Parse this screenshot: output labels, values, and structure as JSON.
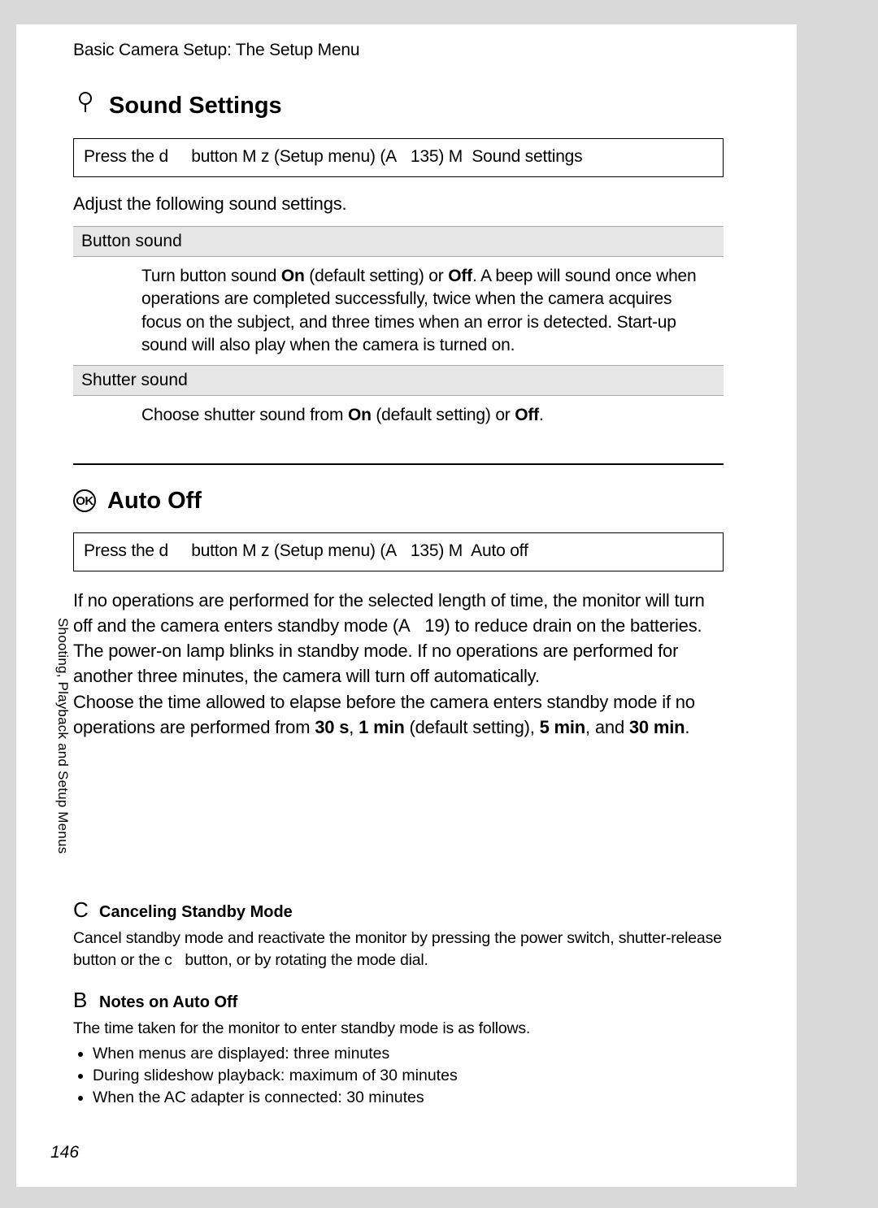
{
  "breadcrumb": "Basic Camera Setup: The Setup Menu",
  "side_label": "Shooting, Playback and Setup Menus",
  "page_number": "146",
  "sound_settings": {
    "icon_name": "sound-icon",
    "title": "Sound Settings",
    "nav_pre": "Press the d",
    "nav_mid1": "button M z  (Setup menu) (A",
    "nav_page": "135) M",
    "nav_end": "Sound settings",
    "intro": "Adjust the following sound settings.",
    "options": [
      {
        "label": "Button sound",
        "desc_pre": "Turn button sound ",
        "on": "On",
        "desc_mid1": " (default setting) or ",
        "off": "Off",
        "desc_post": ". A beep will sound once when operations are completed successfully, twice when the camera acquires focus on the subject, and three times when an error is detected. Start-up sound will also play when the camera is turned on."
      },
      {
        "label": "Shutter sound",
        "desc_pre": "Choose shutter sound from ",
        "on": "On",
        "desc_mid1": " (default setting) or ",
        "off": "Off",
        "desc_post": "."
      }
    ]
  },
  "auto_off": {
    "icon_text": "OK",
    "title": "Auto Off",
    "nav_pre": "Press the d",
    "nav_mid1": "button M z  (Setup menu) (A",
    "nav_page": "135) M",
    "nav_end": "Auto off",
    "para1_pre": "If no operations are performed for the selected length of time, the monitor will turn off and the camera enters standby mode (A",
    "para1_ref": "19) to reduce drain on the batteries. The power-on lamp blinks in standby mode. If no operations are performed for another three minutes, the camera will turn off automatically.",
    "para2_pre": "Choose the time allowed to elapse before the camera enters standby mode if no operations are performed from ",
    "opt1": "30 s",
    "sep1": ", ",
    "opt2": "1 min",
    "def": " (default setting), ",
    "opt3": "5 min",
    "sep2": ", and ",
    "opt4": "30 min",
    "end": "."
  },
  "note_cancel": {
    "icon": "C",
    "title": "Canceling Standby Mode",
    "body_pre": "Cancel standby mode and reactivate the monitor by pressing the power switch, shutter-release button or the ",
    "btn": "c",
    "body_post": " button, or by rotating the mode dial."
  },
  "note_auto": {
    "icon": "B",
    "title": "Notes on Auto Off",
    "intro": "The time taken for the monitor to enter standby mode is as follows.",
    "items": [
      "When menus are displayed: three minutes",
      "During slideshow playback: maximum of 30 minutes",
      "When the AC adapter is connected: 30 minutes"
    ]
  }
}
